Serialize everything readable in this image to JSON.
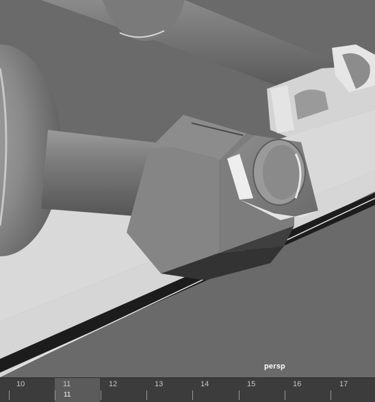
{
  "viewport": {
    "camera_name": "persp",
    "background_color": "#6a6a6a"
  },
  "timeline": {
    "frame_labels": [
      "10",
      "11",
      "12",
      "13",
      "14",
      "15",
      "16",
      "17"
    ],
    "current_frame": "11",
    "highlight_color": "#5b5b5b"
  }
}
